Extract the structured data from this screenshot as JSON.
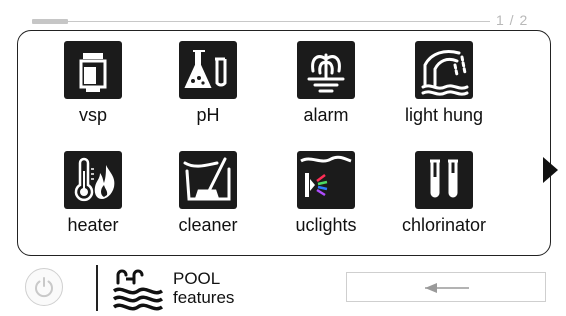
{
  "pager": {
    "page_label": "1 / 2"
  },
  "tiles": [
    {
      "label": "vsp",
      "icon": "pump-icon"
    },
    {
      "label": "pH",
      "icon": "chemistry-flasks-icon"
    },
    {
      "label": "alarm",
      "icon": "fountain-icon"
    },
    {
      "label": "light hung",
      "icon": "waterfall-icon"
    },
    {
      "label": "heater",
      "icon": "thermometer-flame-icon"
    },
    {
      "label": "cleaner",
      "icon": "pool-cleaner-icon"
    },
    {
      "label": "uclights",
      "icon": "underwater-light-icon"
    },
    {
      "label": "chlorinator",
      "icon": "test-tubes-icon"
    }
  ],
  "navigation": {
    "next_icon": "triangle-right-icon",
    "back_icon": "arrow-left-icon"
  },
  "footer": {
    "title_line1": "POOL",
    "title_line2": "features",
    "power_icon": "power-icon",
    "section_icon": "pool-ladder-waves-icon"
  },
  "colors": {
    "icon_bg": "#1b1b1b",
    "panel_border": "#222222",
    "muted": "#c8c8c8"
  }
}
